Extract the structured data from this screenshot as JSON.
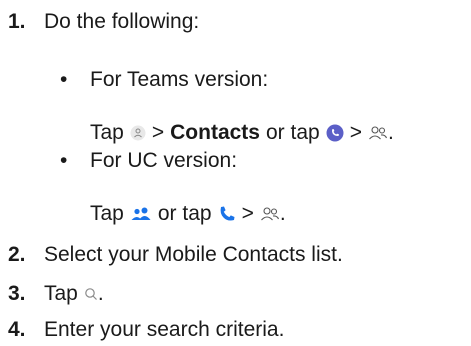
{
  "steps": [
    {
      "number": "1.",
      "text": "Do the following:"
    },
    {
      "number": "2.",
      "text": "Select your Mobile Contacts list."
    },
    {
      "number": "3.",
      "text": "Tap"
    },
    {
      "number": "4.",
      "text": "Enter your search criteria."
    }
  ],
  "step3_suffix": ".",
  "substeps": [
    {
      "bullet": "•",
      "label": "For Teams version:",
      "instruction": {
        "tap": "Tap",
        "gt1": ">",
        "contacts": "Contacts",
        "or_tap": "or tap",
        "gt2": ">",
        "end": "."
      },
      "icons": [
        "avatar-icon",
        "phone-circle-icon",
        "people-icon"
      ]
    },
    {
      "bullet": "•",
      "label": "For UC version:",
      "instruction": {
        "tap": "Tap",
        "or_tap": "or tap",
        "gt": ">",
        "end": "."
      },
      "icons": [
        "people-group-icon",
        "phone-icon",
        "people-icon"
      ]
    }
  ],
  "icons": {
    "search": "search-icon"
  },
  "colors": {
    "text": "#1a1a1a",
    "teams_accent": "#5b5fc7",
    "uc_accent": "#1a73e8",
    "muted_icon": "#8a8a8a"
  }
}
